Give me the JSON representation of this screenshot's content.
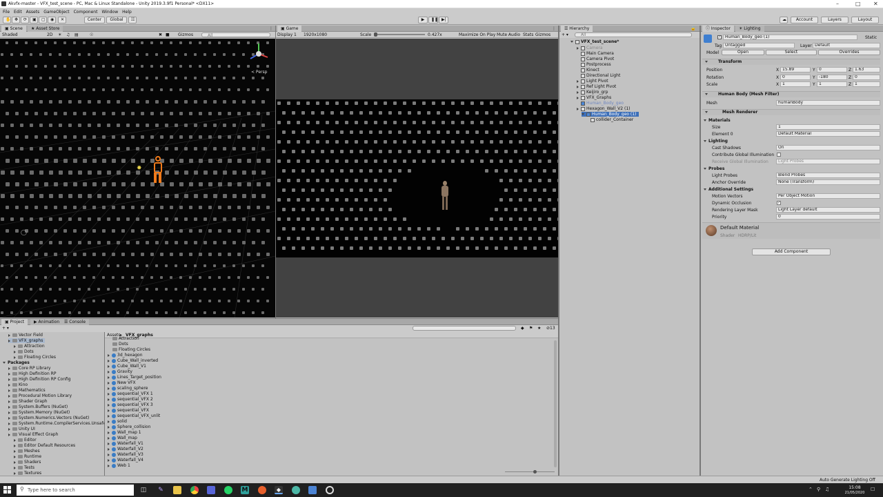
{
  "window": {
    "title": "Akvfx-master - VFX_test_scene - PC, Mac & Linux Standalone - Unity 2019.3.9f1 Personal* <DX11>"
  },
  "menu": [
    "File",
    "Edit",
    "Assets",
    "GameObject",
    "Component",
    "Window",
    "Help"
  ],
  "toolbar": {
    "center": "Center",
    "global": "Global",
    "account": "Account",
    "layers": "Layers",
    "layout": "Layout"
  },
  "scene_tabs": {
    "scene": "Scene",
    "asset_store": "Asset Store"
  },
  "scene_ctrl": {
    "shaded": "Shaded",
    "mode_2d": "2D",
    "gizmos": "Gizmos",
    "search": "All",
    "persp": "< Persp"
  },
  "game_tabs": {
    "game": "Game"
  },
  "game_ctrl": {
    "display": "Display 1",
    "resolution": "1920x1080",
    "scale_label": "Scale",
    "scale_value": "0.427x",
    "maximize": "Maximize On Play",
    "mute": "Mute Audio",
    "stats": "Stats",
    "gizmos": "Gizmos"
  },
  "hierarchy": {
    "tab": "Hierarchy",
    "search": "All",
    "scene": "VFX_test_scene*",
    "items": [
      {
        "label": "Camera",
        "indent": 1,
        "disabled": true,
        "arrow": true
      },
      {
        "label": "Main Camera",
        "indent": 1
      },
      {
        "label": "Camera Pivot",
        "indent": 1
      },
      {
        "label": "Postprocess",
        "indent": 1
      },
      {
        "label": "Kinect",
        "indent": 1
      },
      {
        "label": "Directional Light",
        "indent": 1
      },
      {
        "label": "Light Pivot",
        "indent": 1,
        "arrow": true
      },
      {
        "label": "Ref Light Pivot",
        "indent": 1,
        "arrow": true
      },
      {
        "label": "Keijiro_grp",
        "indent": 1,
        "arrow": true
      },
      {
        "label": "VFX_Graphs",
        "indent": 1,
        "arrow": true
      },
      {
        "label": "Human_Body_geo",
        "indent": 1,
        "disabled": true,
        "blue": true
      },
      {
        "label": "Hexagon_Wall_V2 (1)",
        "indent": 1,
        "arrow": true
      },
      {
        "label": "Human_Body_geo (1)",
        "indent": 2,
        "selected": true,
        "arrow": true
      },
      {
        "label": "collider_Container",
        "indent": 3
      }
    ]
  },
  "inspector": {
    "tab": "Inspector",
    "lighting_tab": "Lighting",
    "object_name": "Human_Body_geo (1)",
    "static": "Static",
    "tag_label": "Tag",
    "tag": "Untagged",
    "layer_label": "Layer",
    "layer": "Default",
    "model_label": "Model",
    "open": "Open",
    "select": "Select",
    "overrides": "Overrides",
    "transform": {
      "title": "Transform",
      "position_label": "Position",
      "rotation_label": "Rotation",
      "scale_label": "Scale",
      "position": {
        "x": "15.89",
        "y": "0",
        "z": "1.63"
      },
      "rotation": {
        "x": "0",
        "y": "-180",
        "z": "0"
      },
      "scale": {
        "x": "1",
        "y": "1",
        "z": "1"
      }
    },
    "mesh_filter": {
      "title": "Human Body (Mesh Filter)",
      "mesh_label": "Mesh",
      "mesh": "humanBody"
    },
    "mesh_renderer": {
      "title": "Mesh Renderer",
      "materials": "Materials",
      "size_label": "Size",
      "size": "1",
      "element0_label": "Element 0",
      "element0": "Default Material",
      "lighting": "Lighting",
      "cast_shadows_label": "Cast Shadows",
      "cast_shadows": "On",
      "contribute_gi": "Contribute Global Illumination",
      "receive_gi_label": "Receive Global Illumination",
      "receive_gi": "Light Probes",
      "probes": "Probes",
      "light_probes_label": "Light Probes",
      "light_probes": "Blend Probes",
      "anchor_label": "Anchor Override",
      "anchor": "None (Transform)",
      "additional": "Additional Settings",
      "motion_label": "Motion Vectors",
      "motion": "Per Object Motion",
      "dynamic_occlusion": "Dynamic Occlusion",
      "rendering_layer_label": "Rendering Layer Mask",
      "rendering_layer": "Light Layer default",
      "priority_label": "Priority",
      "priority": "0"
    },
    "material": {
      "name": "Default Material",
      "shader_label": "Shader",
      "shader": "HDRP/Lit"
    },
    "add_component": "Add Component"
  },
  "project_tabs": {
    "project": "Project",
    "animation": "Animation",
    "console": "Console"
  },
  "project_tree": [
    {
      "label": "Vector Field",
      "indent": 1
    },
    {
      "label": "VFX_graphs",
      "indent": 1,
      "selected": true
    },
    {
      "label": "Attraction",
      "indent": 2
    },
    {
      "label": "Dots",
      "indent": 2
    },
    {
      "label": "Floating Circles",
      "indent": 2
    },
    {
      "label": "Packages",
      "indent": 0,
      "bold": true
    },
    {
      "label": "Core RP Library",
      "indent": 1
    },
    {
      "label": "High Definition RP",
      "indent": 1
    },
    {
      "label": "High Definition RP Config",
      "indent": 1
    },
    {
      "label": "Kino",
      "indent": 1
    },
    {
      "label": "Mathematics",
      "indent": 1
    },
    {
      "label": "Procedural Motion Library",
      "indent": 1
    },
    {
      "label": "Shader Graph",
      "indent": 1
    },
    {
      "label": "System.Buffers (NuGet)",
      "indent": 1
    },
    {
      "label": "System.Memory (NuGet)",
      "indent": 1
    },
    {
      "label": "System.Numerics.Vectors (NuGet)",
      "indent": 1
    },
    {
      "label": "System.Runtime.CompilerServices.Unsafe (",
      "indent": 1
    },
    {
      "label": "Unity UI",
      "indent": 1
    },
    {
      "label": "Visual Effect Graph",
      "indent": 1
    },
    {
      "label": "Editor",
      "indent": 2
    },
    {
      "label": "Editor Default Resources",
      "indent": 2
    },
    {
      "label": "Meshes",
      "indent": 2
    },
    {
      "label": "Runtime",
      "indent": 2
    },
    {
      "label": "Shaders",
      "indent": 2
    },
    {
      "label": "Tests",
      "indent": 2
    },
    {
      "label": "Textures",
      "indent": 2
    }
  ],
  "project_path": {
    "assets": "Assets",
    "current": "VFX_graphs"
  },
  "project_count": "13",
  "project_files": [
    {
      "label": "Attraction",
      "type": "folder"
    },
    {
      "label": "Dots",
      "type": "folder"
    },
    {
      "label": "Floating Circles",
      "type": "folder"
    },
    {
      "label": "3d_hexagon",
      "type": "vfx"
    },
    {
      "label": "Cube_Wall_inverted",
      "type": "vfx"
    },
    {
      "label": "Cube_Wall_V1",
      "type": "vfx"
    },
    {
      "label": "Gravity",
      "type": "vfx"
    },
    {
      "label": "Lines_Target_position",
      "type": "vfx"
    },
    {
      "label": "New VFX",
      "type": "vfx"
    },
    {
      "label": "scaling_sphere",
      "type": "vfx"
    },
    {
      "label": "sequential_VFX 1",
      "type": "vfx"
    },
    {
      "label": "sequential_VFX 2",
      "type": "vfx"
    },
    {
      "label": "sequential_VFX 3",
      "type": "vfx"
    },
    {
      "label": "sequential_VFX",
      "type": "vfx"
    },
    {
      "label": "sequential_VFX_unlit",
      "type": "vfx"
    },
    {
      "label": "solid",
      "type": "vfx"
    },
    {
      "label": "Sphere_collision",
      "type": "vfx"
    },
    {
      "label": "Wall_map 1",
      "type": "vfx"
    },
    {
      "label": "Wall_map",
      "type": "vfx"
    },
    {
      "label": "Waterfall_V1",
      "type": "vfx"
    },
    {
      "label": "Waterfall_V2",
      "type": "vfx"
    },
    {
      "label": "Waterfall_V3",
      "type": "vfx"
    },
    {
      "label": "Waterfall_V4",
      "type": "vfx"
    },
    {
      "label": "Web 1",
      "type": "vfx"
    }
  ],
  "status": {
    "right": "Auto Generate Lighting Off"
  },
  "taskbar": {
    "search_placeholder": "Type here to search",
    "time": "15:08",
    "date": "21/05/2020"
  },
  "colors": {
    "selected": "#3d6fb8",
    "editor_bg": "#c2c2c2",
    "accent": "#2b73c8"
  }
}
